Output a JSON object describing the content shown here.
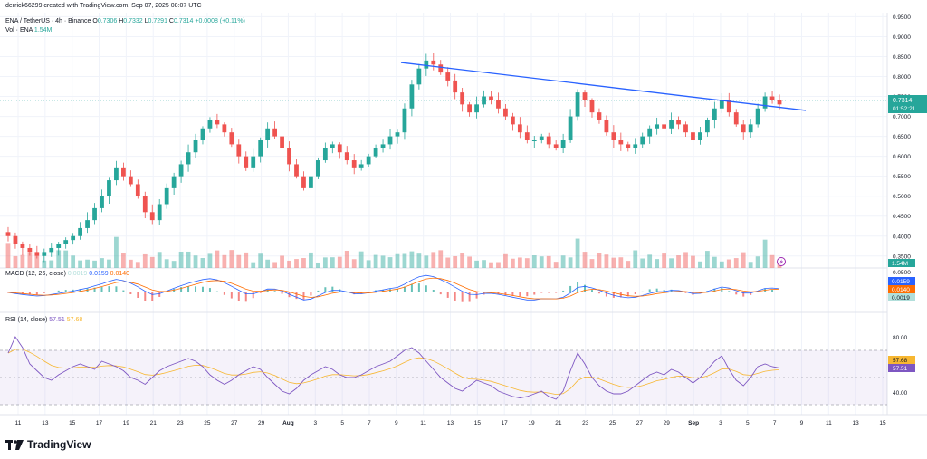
{
  "credit": "derrick66299 created with TradingView.com, Sep 07, 2025 08:07 UTC",
  "header": {
    "pair": "ENA / TetherUS · 4h · Binance",
    "o_label": "O",
    "o": "0.7306",
    "h_label": "H",
    "h": "0.7332",
    "l_label": "L",
    "l": "0.7291",
    "c_label": "C",
    "c": "0.7314",
    "change": "+0.0008 (+0.11%)",
    "vol_label": "Vol · ENA",
    "vol": "1.54M"
  },
  "price_axis": {
    "ticks": [
      "0.9500",
      "0.9000",
      "0.8500",
      "0.8000",
      "0.7500",
      "0.7000",
      "0.6500",
      "0.6000",
      "0.5500",
      "0.5000",
      "0.4500",
      "0.4000",
      "0.3500"
    ],
    "last_price": "0.7314",
    "countdown": "01:52:21",
    "volume_tag": "1.54M"
  },
  "macd": {
    "title": "MACD (12, 26, close)",
    "hist": "0.0019",
    "macd": "0.0159",
    "signal": "0.0140",
    "axis_top": "0.0500",
    "hist_color": "#26a69a",
    "macd_color": "#2962ff",
    "signal_color": "#ff6d00"
  },
  "rsi": {
    "title": "RSI (14, close)",
    "value": "57.51",
    "ma": "57.68",
    "ticks": [
      "80.00",
      "40.00"
    ],
    "rsi_color": "#7e57c2",
    "ma_color": "#f7b731"
  },
  "time_axis": [
    "11",
    "13",
    "15",
    "17",
    "19",
    "21",
    "23",
    "25",
    "27",
    "29",
    "Aug",
    "3",
    "5",
    "7",
    "9",
    "11",
    "13",
    "15",
    "17",
    "19",
    "21",
    "23",
    "25",
    "27",
    "29",
    "Sep",
    "3",
    "5",
    "7",
    "9",
    "11",
    "13",
    "15"
  ],
  "brand": "TradingView",
  "colors": {
    "up": "#26a69a",
    "down": "#ef5350",
    "trendline": "#2962ff",
    "grid": "#f0f3fa"
  },
  "chart_data": {
    "type": "candlestick",
    "timeframe": "4h",
    "ylim": [
      0.32,
      0.96
    ],
    "closes": [
      0.4,
      0.38,
      0.37,
      0.36,
      0.35,
      0.36,
      0.37,
      0.38,
      0.39,
      0.4,
      0.42,
      0.44,
      0.47,
      0.5,
      0.54,
      0.57,
      0.55,
      0.53,
      0.5,
      0.46,
      0.44,
      0.48,
      0.52,
      0.55,
      0.58,
      0.61,
      0.64,
      0.67,
      0.69,
      0.68,
      0.66,
      0.63,
      0.6,
      0.57,
      0.6,
      0.64,
      0.67,
      0.65,
      0.62,
      0.58,
      0.55,
      0.52,
      0.55,
      0.59,
      0.62,
      0.63,
      0.61,
      0.59,
      0.57,
      0.58,
      0.6,
      0.62,
      0.63,
      0.65,
      0.66,
      0.72,
      0.78,
      0.82,
      0.84,
      0.83,
      0.81,
      0.79,
      0.76,
      0.73,
      0.71,
      0.73,
      0.75,
      0.74,
      0.72,
      0.7,
      0.68,
      0.66,
      0.64,
      0.64,
      0.65,
      0.63,
      0.62,
      0.64,
      0.7,
      0.76,
      0.74,
      0.71,
      0.69,
      0.66,
      0.64,
      0.63,
      0.62,
      0.63,
      0.65,
      0.67,
      0.68,
      0.67,
      0.69,
      0.68,
      0.66,
      0.64,
      0.66,
      0.69,
      0.72,
      0.74,
      0.71,
      0.68,
      0.66,
      0.68,
      0.72,
      0.75,
      0.74,
      0.73
    ],
    "trendline": {
      "start": 0.835,
      "end": 0.715
    },
    "rsi": [
      68,
      80,
      72,
      60,
      55,
      50,
      48,
      52,
      55,
      58,
      60,
      58,
      56,
      62,
      60,
      58,
      55,
      50,
      48,
      45,
      50,
      55,
      58,
      60,
      62,
      64,
      62,
      58,
      52,
      48,
      45,
      48,
      52,
      55,
      58,
      56,
      50,
      45,
      40,
      38,
      42,
      48,
      52,
      55,
      58,
      56,
      52,
      50,
      50,
      52,
      55,
      58,
      60,
      62,
      66,
      70,
      72,
      68,
      62,
      56,
      50,
      46,
      42,
      40,
      44,
      48,
      46,
      44,
      40,
      38,
      36,
      35,
      36,
      38,
      40,
      36,
      34,
      40,
      55,
      68,
      60,
      50,
      44,
      40,
      38,
      38,
      40,
      44,
      48,
      52,
      54,
      52,
      56,
      54,
      50,
      46,
      50,
      56,
      62,
      66,
      56,
      48,
      44,
      50,
      58,
      60,
      58,
      57
    ]
  }
}
